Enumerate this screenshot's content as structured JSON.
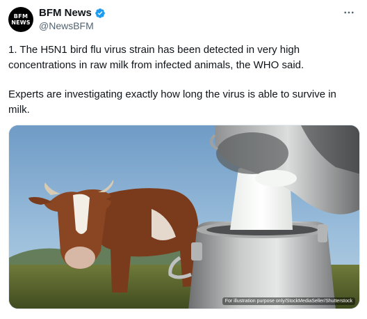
{
  "author": {
    "avatar_line1": "BFM",
    "avatar_line2": "NEWS",
    "display_name": "BFM News",
    "handle": "@NewsBFM",
    "verified_color": "#1d9bf0"
  },
  "tweet": {
    "paragraph1": "1. The H5N1 bird flu virus strain has been detected in very high concentrations in raw milk from infected animals, the WHO said.",
    "paragraph2": "Experts are investigating exactly how long the virus is able to survive in milk."
  },
  "media": {
    "caption": "For illustration purpose only/StockMediaSeller/Shutterstock"
  },
  "icons": {
    "more": "more-horizontal-icon",
    "verified": "verified-badge-icon"
  }
}
